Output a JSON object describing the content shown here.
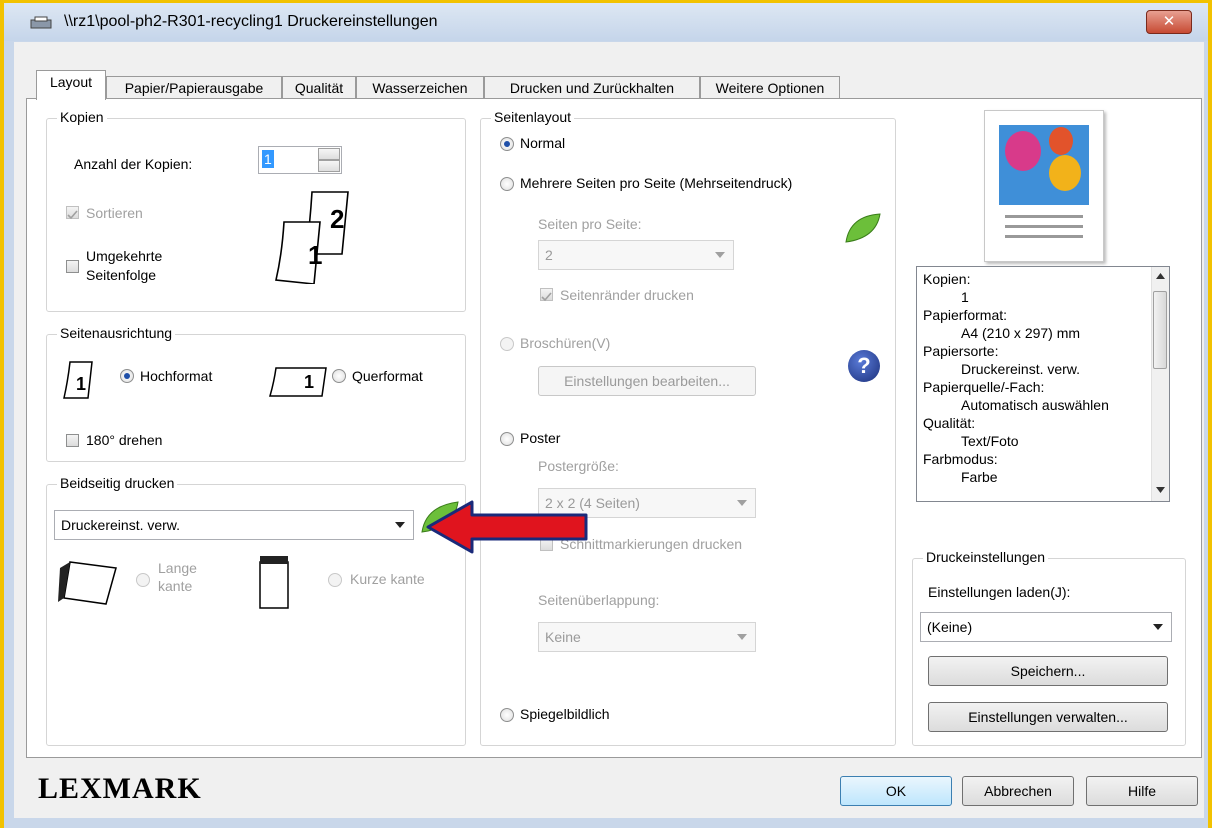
{
  "window": {
    "title": "\\\\rz1\\pool-ph2-R301-recycling1 Druckereinstellungen",
    "close_label": "✕"
  },
  "tabs": [
    {
      "label": "Layout"
    },
    {
      "label": "Papier/Papierausgabe"
    },
    {
      "label": "Qualität"
    },
    {
      "label": "Wasserzeichen"
    },
    {
      "label": "Drucken und Zurückhalten"
    },
    {
      "label": "Weitere Optionen"
    }
  ],
  "kopien": {
    "legend": "Kopien",
    "anzahl_label": "Anzahl der Kopien:",
    "anzahl_value": "1",
    "sortieren_label": "Sortieren",
    "sortieren_checked": true,
    "umgekehrt_label_1": "Umgekehrte",
    "umgekehrt_label_2": "Seitenfolge",
    "umgekehrt_checked": false,
    "page_num_1": "1",
    "page_num_2": "2"
  },
  "ausrichtung": {
    "legend": "Seitenausrichtung",
    "hochformat_label": "Hochformat",
    "querformat_label": "Querformat",
    "drehen_label": "180° drehen",
    "page_num": "1"
  },
  "beidseitig": {
    "legend": "Beidseitig drucken",
    "select_value": "Druckereinst. verw.",
    "lange_label_1": "Lange",
    "lange_label_2": "kante",
    "kurze_label": "Kurze kante"
  },
  "seitenlayout": {
    "legend": "Seitenlayout",
    "normal_label": "Normal",
    "mehrere_label": "Mehrere Seiten pro Seite (Mehrseitendruck)",
    "seiten_pro_seite_label": "Seiten pro Seite:",
    "seiten_pro_seite_value": "2",
    "seitenraender_label": "Seitenränder drucken",
    "broschueren_label": "Broschüren(V)",
    "einstellungen_bearbeiten_label": "Einstellungen bearbeiten...",
    "poster_label": "Poster",
    "postergroesse_label": "Postergröße:",
    "postergroesse_value": "2 x 2 (4 Seiten)",
    "schnitt_label": "Schnittmarkierungen drucken",
    "ueberlappung_label": "Seitenüberlappung:",
    "ueberlappung_value": "Keine",
    "spiegel_label": "Spiegelbildlich"
  },
  "summary": {
    "lines": [
      {
        "text": "Kopien:",
        "indent": false
      },
      {
        "text": "1",
        "indent": true
      },
      {
        "text": "Papierformat:",
        "indent": false
      },
      {
        "text": "A4 (210 x 297) mm",
        "indent": true
      },
      {
        "text": "Papiersorte:",
        "indent": false
      },
      {
        "text": "Druckereinst. verw.",
        "indent": true
      },
      {
        "text": "Papierquelle/-Fach:",
        "indent": false
      },
      {
        "text": "Automatisch auswählen",
        "indent": true
      },
      {
        "text": "Qualität:",
        "indent": false
      },
      {
        "text": "Text/Foto",
        "indent": true
      },
      {
        "text": "Farbmodus:",
        "indent": false
      },
      {
        "text": "Farbe",
        "indent": true
      }
    ]
  },
  "druckeinstellungen": {
    "legend": "Druckeinstellungen",
    "laden_label": "Einstellungen laden(J):",
    "laden_value": "(Keine)",
    "speichern_label": "Speichern...",
    "verwalten_label": "Einstellungen verwalten..."
  },
  "footer": {
    "brand": "LEXMARK",
    "ok_label": "OK",
    "abbrechen_label": "Abbrechen",
    "hilfe_label": "Hilfe"
  },
  "colors": {
    "accent_arrow_fill": "#e0141e",
    "accent_arrow_stroke": "#1a2a7a",
    "frame_border": "#f2c200"
  }
}
